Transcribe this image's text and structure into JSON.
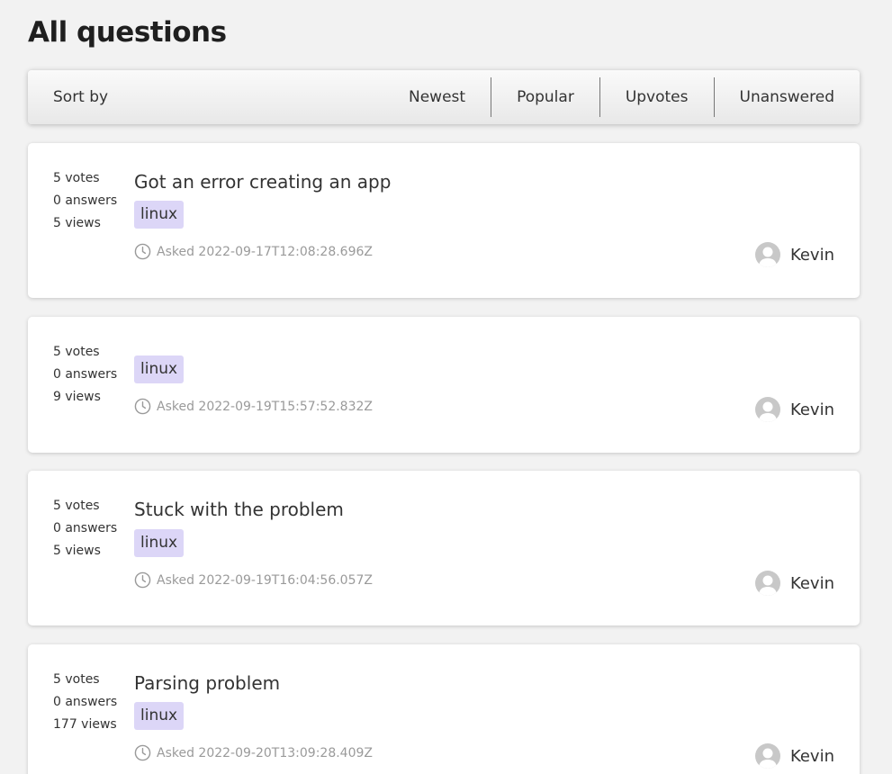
{
  "page": {
    "title": "All questions"
  },
  "sortbar": {
    "label": "Sort by",
    "options": [
      "Newest",
      "Popular",
      "Upvotes",
      "Unanswered"
    ]
  },
  "questions": [
    {
      "votes": "5 votes",
      "answers": "0 answers",
      "views": "5 views",
      "title": "Got an error creating an app",
      "tag": "linux",
      "asked": "Asked 2022-09-17T12:08:28.696Z",
      "author": "Kevin"
    },
    {
      "votes": "5 votes",
      "answers": "0 answers",
      "views": "9 views",
      "title": "",
      "tag": "linux",
      "asked": "Asked 2022-09-19T15:57:52.832Z",
      "author": "Kevin"
    },
    {
      "votes": "5 votes",
      "answers": "0 answers",
      "views": "5 views",
      "title": "Stuck with the problem",
      "tag": "linux",
      "asked": "Asked 2022-09-19T16:04:56.057Z",
      "author": "Kevin"
    },
    {
      "votes": "5 votes",
      "answers": "0 answers",
      "views": "177 views",
      "title": "Parsing problem",
      "tag": "linux",
      "asked": "Asked 2022-09-20T13:09:28.409Z",
      "author": "Kevin"
    }
  ],
  "icons": {
    "clock": "clock-icon",
    "avatar": "user-avatar-icon"
  },
  "colors": {
    "tag_bg": "#dcd6f7",
    "background": "#f2f2f2",
    "muted": "#9a9a9a"
  }
}
